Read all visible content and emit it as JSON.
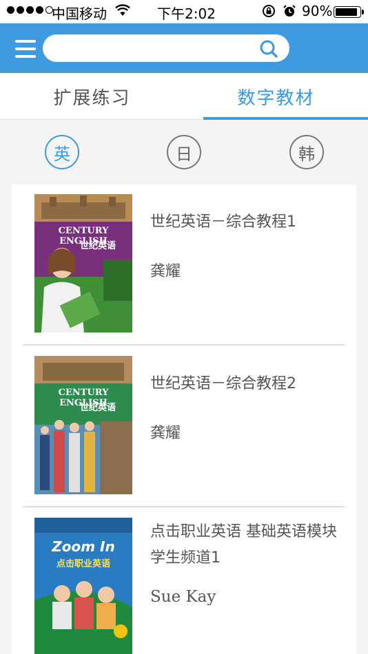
{
  "status_bar": {
    "carrier": "中国移动",
    "time": "下午2:02",
    "battery": "90%",
    "battery_level": 0.9
  },
  "header": {
    "search": {
      "value": "",
      "placeholder": ""
    }
  },
  "tabs": [
    {
      "label": "扩展练习",
      "active": false
    },
    {
      "label": "数字教材",
      "active": true
    }
  ],
  "languages": [
    {
      "label": "英",
      "active": true
    },
    {
      "label": "日",
      "active": false
    },
    {
      "label": "韩",
      "active": false
    }
  ],
  "books": [
    {
      "title": "世纪英语－综合教程1",
      "author": "龚耀",
      "cover": {
        "title": "CENTURY ENGLISH",
        "subtitle": "世纪英语",
        "color": "#7a2f7d"
      }
    },
    {
      "title": "世纪英语－综合教程2",
      "author": "龚耀",
      "cover": {
        "title": "CENTURY ENGLISH",
        "subtitle": "世纪英语",
        "color": "#2e8b4e"
      }
    },
    {
      "title": "点击职业英语 基础英语模块 学生频道1",
      "author": "Sue Kay",
      "cover": {
        "title": "Zoom In",
        "subtitle": "点击职业英语",
        "color": "#2a7cc2"
      }
    }
  ],
  "colors": {
    "accent": "#3a9be0",
    "header_bg": "#3f9bdf"
  }
}
